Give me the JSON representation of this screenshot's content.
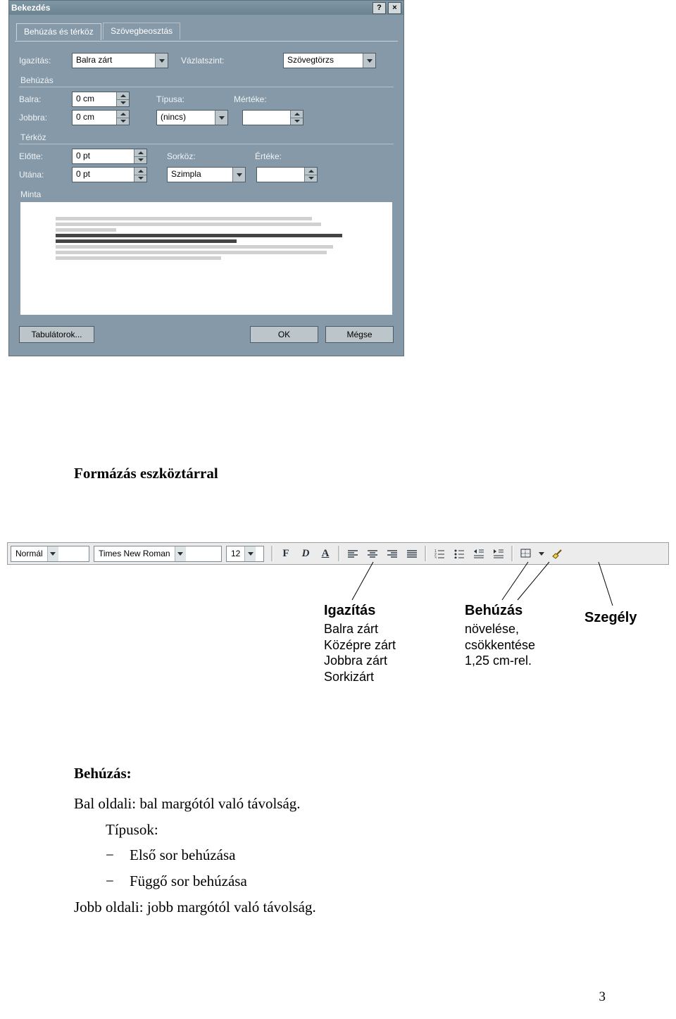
{
  "dialog": {
    "title": "Bekezdés",
    "tabs": {
      "t1": "Behúzás és térköz",
      "t2": "Szövegbeosztás"
    },
    "igazitas_label": "Igazítás:",
    "igazitas_value": "Balra zárt",
    "vazlatszint_label": "Vázlatszint:",
    "vazlatszint_value": "Szövegtörzs",
    "behuzas_label": "Behúzás",
    "balra_label": "Balra:",
    "balra_value": "0 cm",
    "jobbra_label": "Jobbra:",
    "jobbra_value": "0 cm",
    "tipusa_label": "Típusa:",
    "tipusa_value": "(nincs)",
    "merteke_label": "Mértéke:",
    "merteke_value": "",
    "terkoz_label": "Térköz",
    "elotte_label": "Előtte:",
    "elotte_value": "0 pt",
    "utana_label": "Utána:",
    "utana_value": "0 pt",
    "sorkoz_label": "Sorköz:",
    "sorkoz_value": "Szimpla",
    "erteke_label": "Értéke:",
    "erteke_value": "",
    "minta_label": "Minta",
    "tabulators_btn": "Tabulátorok...",
    "ok_btn": "OK",
    "cancel_btn": "Mégse"
  },
  "doc_section_title": "Formázás eszköztárral",
  "toolbar": {
    "style": "Normál",
    "font": "Times New Roman",
    "size": "12"
  },
  "annotations": {
    "igazitas": {
      "title": "Igazítás",
      "l1": "Balra zárt",
      "l2": "Középre zárt",
      "l3": "Jobbra zárt",
      "l4": "Sorkizárt"
    },
    "behuzas": {
      "title": "Behúzás",
      "l1": "növelése,",
      "l2": "csökkentése",
      "l3": "1,25 cm-rel."
    },
    "szegely": {
      "title": "Szegély"
    }
  },
  "content": {
    "heading": "Behúzás:",
    "bal": "Bal oldali: bal margótól való távolság.",
    "tipusok": "Típusok:",
    "li1": "Első sor behúzása",
    "li2": "Függő sor behúzása",
    "jobb": "Jobb oldali: jobb margótól való távolság."
  },
  "page_number": "3"
}
